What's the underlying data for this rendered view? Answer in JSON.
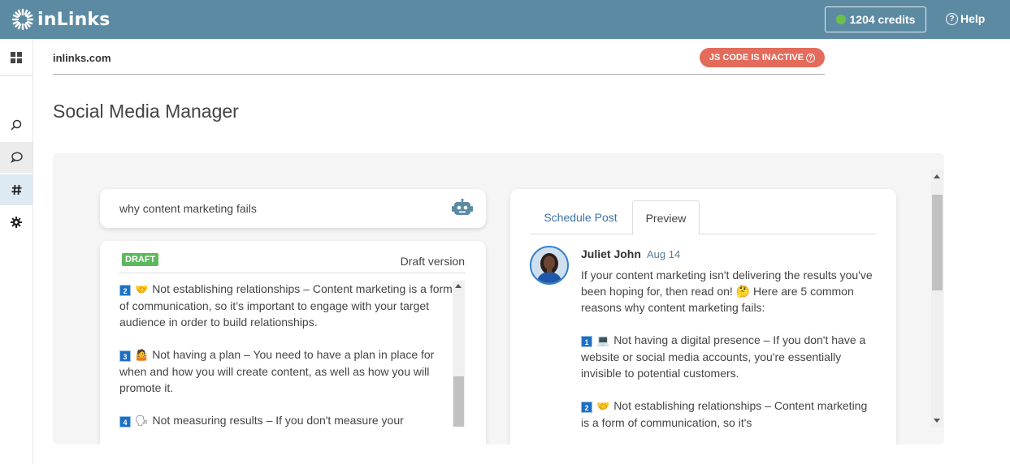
{
  "app": {
    "brand": "inLinks",
    "credits": "1204 credits",
    "help": "Help"
  },
  "colors": {
    "topbar": "#5c8aa3",
    "badge_inactive": "#e36b5b",
    "draft_badge": "#5cb85c",
    "link_blue": "#3a73ad",
    "credits_dot": "#6cc04a"
  },
  "sidebar": {
    "items": [
      {
        "icon": "grid-icon"
      },
      {
        "icon": "search-icon"
      },
      {
        "icon": "chat-icon"
      },
      {
        "icon": "hashtag-icon"
      },
      {
        "icon": "gear-icon"
      }
    ]
  },
  "site": {
    "domain": "inlinks.com",
    "js_status": "JS CODE IS INACTIVE"
  },
  "page": {
    "title": "Social Media Manager"
  },
  "search": {
    "query": "why content marketing fails"
  },
  "draft": {
    "badge": "DRAFT",
    "version": "Draft version",
    "items": [
      {
        "num": "2",
        "emoji": "🤝",
        "text": "Not establishing relationships – Content marketing is a form of communication, so it’s important to engage with your target audience in order to build relationships."
      },
      {
        "num": "3",
        "emoji": "🤷",
        "text": "Not having a plan – You need to have a plan in place for when and how you will create content, as well as how you will promote it."
      },
      {
        "num": "4",
        "emoji": "🗣",
        "text": "Not measuring results – If you don't measure your"
      }
    ]
  },
  "preview": {
    "tabs": [
      "Schedule Post",
      "Preview"
    ],
    "author": "Juliet John",
    "date": "Aug 14",
    "intro": "If your content marketing isn't delivering the results you've been hoping for, then read on! 🤔 Here are 5 common reasons why content marketing fails:",
    "items": [
      {
        "num": "1",
        "emoji": "💻",
        "text": "Not having a digital presence – If you don't have a website or social media accounts, you're essentially invisible to potential customers."
      },
      {
        "num": "2",
        "emoji": "🤝",
        "text": "Not establishing relationships – Content marketing is a form of communication, so it's"
      }
    ]
  }
}
